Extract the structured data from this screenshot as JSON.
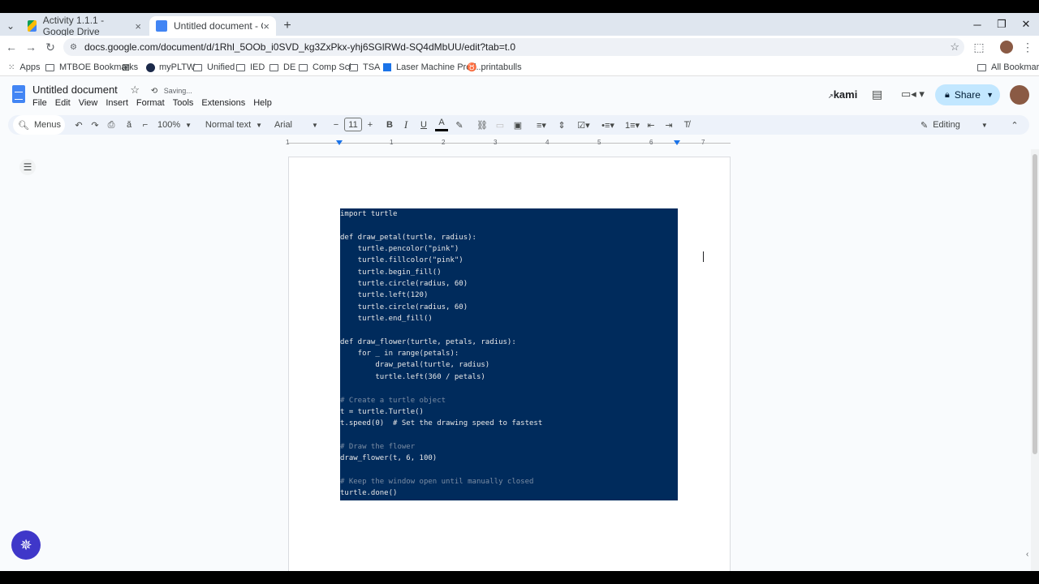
{
  "browser": {
    "tabs": [
      {
        "title": "Activity 1.1.1 - Google Drive",
        "active": false
      },
      {
        "title": "Untitled document - Google Do",
        "active": true
      }
    ],
    "url": "docs.google.com/document/d/1Rhl_5OOb_i0SVD_kg3ZxPkx-yhj6SGlRWd-SQ4dMbUU/edit?tab=t.0",
    "bookmarks": [
      "Apps",
      "MTBOE Bookmarks",
      "myPLTW",
      "Unified",
      "IED",
      "DE",
      "Comp Sci",
      "TSA",
      "Laser Machine Prod...",
      "printabulls"
    ],
    "all_bookmarks": "All Bookmarks"
  },
  "docs": {
    "title": "Untitled document",
    "status": "Saving...",
    "menus": [
      "File",
      "Edit",
      "View",
      "Insert",
      "Format",
      "Tools",
      "Extensions",
      "Help"
    ],
    "kami_label": "kami",
    "share_label": "Share",
    "toolbar": {
      "search_label": "Menus",
      "zoom": "100%",
      "style": "Normal text",
      "font": "Arial",
      "font_size": "11",
      "mode": "Editing"
    },
    "ruler_numbers": [
      "1",
      "1",
      "2",
      "3",
      "4",
      "5",
      "6",
      "7"
    ]
  },
  "code_lines": [
    "import turtle",
    "",
    "def draw_petal(turtle, radius):",
    "    turtle.pencolor(\"pink\")",
    "    turtle.fillcolor(\"pink\")",
    "    turtle.begin_fill()",
    "    turtle.circle(radius, 60)",
    "    turtle.left(120)",
    "    turtle.circle(radius, 60)",
    "    turtle.end_fill()",
    "",
    "def draw_flower(turtle, petals, radius):",
    "    for _ in range(petals):",
    "        draw_petal(turtle, radius)",
    "        turtle.left(360 / petals)",
    "",
    "# Create a turtle object",
    "t = turtle.Turtle()",
    "t.speed(0)  # Set the drawing speed to fastest",
    "",
    "# Draw the flower",
    "draw_flower(t, 6, 100)",
    "",
    "# Keep the window open until manually closed",
    "turtle.done()"
  ],
  "colors": {
    "code_bg": "#002b5c",
    "share_bg": "#c2e7ff",
    "toolbar_bg": "#edf2fa"
  }
}
